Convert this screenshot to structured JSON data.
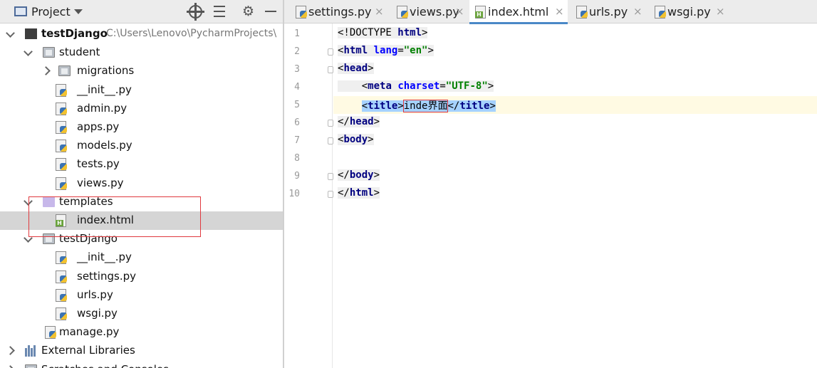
{
  "project_panel": {
    "title": "Project",
    "tree": [
      {
        "label": "testDjango",
        "path": "C:\\Users\\Lenovo\\PycharmProjects\\",
        "bold": true,
        "type": "folder-dark",
        "arrow": "open",
        "indent": 0
      },
      {
        "label": "student",
        "type": "folder-grey",
        "arrow": "open",
        "indent": 1
      },
      {
        "label": "migrations",
        "type": "folder-grey",
        "arrow": "closed",
        "indent": 2
      },
      {
        "label": "__init__.py",
        "type": "py",
        "indent": 2
      },
      {
        "label": "admin.py",
        "type": "py",
        "indent": 2
      },
      {
        "label": "apps.py",
        "type": "py",
        "indent": 2
      },
      {
        "label": "models.py",
        "type": "py",
        "indent": 2
      },
      {
        "label": "tests.py",
        "type": "py",
        "indent": 2
      },
      {
        "label": "views.py",
        "type": "py",
        "indent": 2
      },
      {
        "label": "templates",
        "type": "folder-purple",
        "arrow": "open",
        "indent": 1
      },
      {
        "label": "index.html",
        "type": "html",
        "indent": 2,
        "selected": true
      },
      {
        "label": "testDjango",
        "type": "folder-grey",
        "arrow": "open",
        "indent": 1
      },
      {
        "label": "__init__.py",
        "type": "py",
        "indent": 2
      },
      {
        "label": "settings.py",
        "type": "py",
        "indent": 2
      },
      {
        "label": "urls.py",
        "type": "py",
        "indent": 2
      },
      {
        "label": "wsgi.py",
        "type": "py",
        "indent": 2
      },
      {
        "label": "manage.py",
        "type": "py",
        "indent": 1
      },
      {
        "label": "External Libraries",
        "type": "lib",
        "arrow": "closed",
        "indent": 0
      },
      {
        "label": "Scratches and Consoles",
        "type": "folder-grey",
        "arrow": "closed",
        "indent": 0
      }
    ]
  },
  "editor": {
    "tabs": [
      {
        "label": "settings.py",
        "type": "py"
      },
      {
        "label": "views.py",
        "type": "py"
      },
      {
        "label": "index.html",
        "type": "html",
        "active": true
      },
      {
        "label": "urls.py",
        "type": "py"
      },
      {
        "label": "wsgi.py",
        "type": "py"
      }
    ],
    "close_glyph": "×",
    "current_line": 5,
    "lines": [
      {
        "n": "1",
        "segs": [
          [
            "",
            "<!DOCTYPE "
          ],
          [
            "tg",
            "html"
          ],
          [
            "",
            ">"
          ]
        ]
      },
      {
        "n": "2",
        "fold": true,
        "segs": [
          [
            "",
            "<"
          ],
          [
            "tg",
            "html "
          ],
          [
            "at",
            "lang"
          ],
          [
            "",
            "="
          ],
          [
            "st",
            "\"en\""
          ],
          [
            "",
            ">"
          ]
        ]
      },
      {
        "n": "3",
        "fold": true,
        "segs": [
          [
            "",
            "<"
          ],
          [
            "tg",
            "head"
          ],
          [
            "",
            ">"
          ]
        ]
      },
      {
        "n": "4",
        "segs": [
          [
            "",
            "    <"
          ],
          [
            "tg",
            "meta "
          ],
          [
            "at",
            "charset"
          ],
          [
            "",
            "="
          ],
          [
            "st",
            "\"UTF-8\""
          ],
          [
            "",
            ">"
          ]
        ]
      },
      {
        "n": "5",
        "segs": [
          [
            "",
            "    "
          ],
          [
            "sel",
            "<"
          ],
          [
            "sel tg",
            "title"
          ],
          [
            "sel",
            ">"
          ],
          [
            "sel txt-box",
            "inde界面"
          ],
          [
            "sel",
            "</"
          ],
          [
            "sel tg",
            "title"
          ],
          [
            "sel",
            ">"
          ]
        ]
      },
      {
        "n": "6",
        "fold": true,
        "segs": [
          [
            "",
            "</"
          ],
          [
            "tg",
            "head"
          ],
          [
            "",
            ">"
          ]
        ]
      },
      {
        "n": "7",
        "fold": true,
        "segs": [
          [
            "",
            "<"
          ],
          [
            "tg",
            "body"
          ],
          [
            "",
            ">"
          ]
        ]
      },
      {
        "n": "8",
        "segs": []
      },
      {
        "n": "9",
        "fold": true,
        "segs": [
          [
            "",
            "</"
          ],
          [
            "tg",
            "body"
          ],
          [
            "",
            ">"
          ]
        ]
      },
      {
        "n": "10",
        "fold": true,
        "segs": [
          [
            "",
            "</"
          ],
          [
            "tg",
            "html"
          ],
          [
            "",
            ">"
          ]
        ]
      }
    ]
  },
  "colors": {
    "selection": "#a6d2ff",
    "current_line": "#fffae3",
    "tag": "#000080",
    "attribute": "#0000ff",
    "string": "#008000",
    "annotation_box": "#e0393e",
    "active_tab_underline": "#4a88c7"
  },
  "icons": [
    "folder-icon",
    "dropdown-arrow-icon",
    "locate-icon",
    "collapse-all-icon",
    "gear-icon",
    "hide-icon",
    "python-file-icon",
    "html-file-icon",
    "library-icon",
    "close-icon"
  ]
}
